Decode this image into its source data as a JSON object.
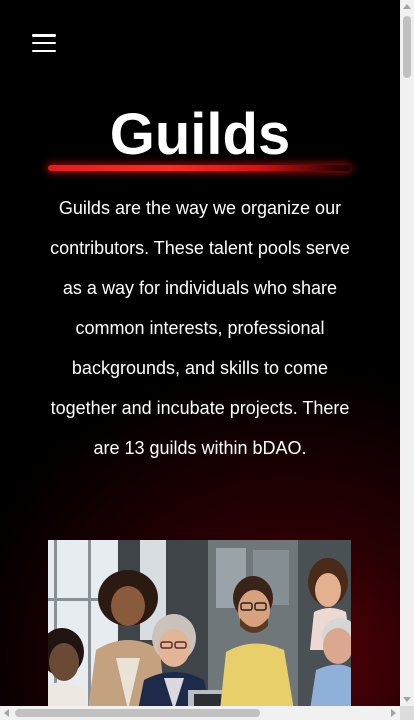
{
  "page": {
    "title": "Guilds",
    "description": "Guilds are the way we organize our contributors. These talent pools serve as a way for individuals who share common interests, professional backgrounds, and skills to come together and incubate projects. There are 13 guilds within bDAO."
  },
  "nav": {
    "menu_icon": "hamburger-menu-icon"
  },
  "colors": {
    "background": "#000000",
    "accent_glow": "#8a000c",
    "underline": "#ff2a1f",
    "text": "#ffffff"
  },
  "image": {
    "semantic": "team-collaboration-photo"
  }
}
